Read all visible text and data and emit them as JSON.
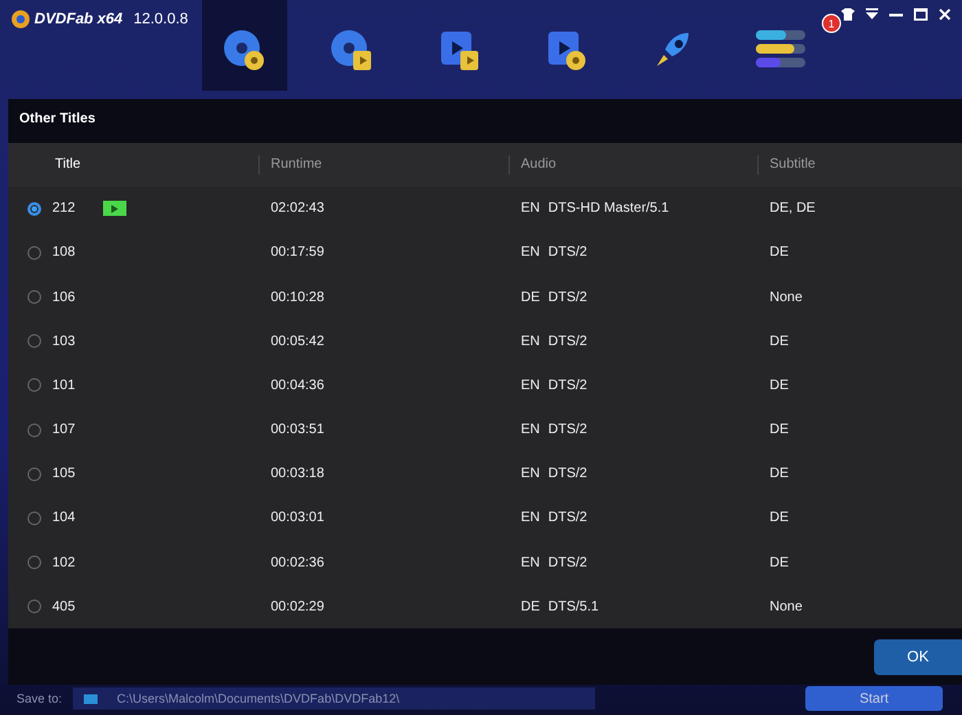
{
  "app": {
    "logo": "DVDFab",
    "edition": "x64",
    "version": "12.0.0.8",
    "notification_count": "1"
  },
  "modules": [
    {
      "kind": "copy",
      "selected": true
    },
    {
      "kind": "ripper",
      "selected": false
    },
    {
      "kind": "converter",
      "selected": false
    },
    {
      "kind": "creator",
      "selected": false
    },
    {
      "kind": "launch",
      "selected": false
    },
    {
      "kind": "queue",
      "selected": false
    }
  ],
  "dialog": {
    "title": "Other Titles",
    "columns": [
      "Title",
      "Runtime",
      "Audio",
      "Subtitle"
    ],
    "rows": [
      {
        "title": "212",
        "preview": true,
        "selected": true,
        "runtime": "02:02:43",
        "audio_language": "EN",
        "audio_format": "DTS-HD Master/5.1",
        "subtitle": "DE, DE"
      },
      {
        "title": "108",
        "preview": false,
        "selected": false,
        "runtime": "00:17:59",
        "audio_language": "EN",
        "audio_format": "DTS/2",
        "subtitle": "DE"
      },
      {
        "title": "106",
        "preview": false,
        "selected": false,
        "runtime": "00:10:28",
        "audio_language": "DE",
        "audio_format": "DTS/2",
        "subtitle": "None"
      },
      {
        "title": "103",
        "preview": false,
        "selected": false,
        "runtime": "00:05:42",
        "audio_language": "EN",
        "audio_format": "DTS/2",
        "subtitle": "DE"
      },
      {
        "title": "101",
        "preview": false,
        "selected": false,
        "runtime": "00:04:36",
        "audio_language": "EN",
        "audio_format": "DTS/2",
        "subtitle": "DE"
      },
      {
        "title": "107",
        "preview": false,
        "selected": false,
        "runtime": "00:03:51",
        "audio_language": "EN",
        "audio_format": "DTS/2",
        "subtitle": "DE"
      },
      {
        "title": "105",
        "preview": false,
        "selected": false,
        "runtime": "00:03:18",
        "audio_language": "EN",
        "audio_format": "DTS/2",
        "subtitle": "DE"
      },
      {
        "title": "104",
        "preview": false,
        "selected": false,
        "runtime": "00:03:01",
        "audio_language": "EN",
        "audio_format": "DTS/2",
        "subtitle": "DE"
      },
      {
        "title": "102",
        "preview": false,
        "selected": false,
        "runtime": "00:02:36",
        "audio_language": "EN",
        "audio_format": "DTS/2",
        "subtitle": "DE"
      },
      {
        "title": "405",
        "preview": false,
        "selected": false,
        "runtime": "00:02:29",
        "audio_language": "DE",
        "audio_format": "DTS/5.1",
        "subtitle": "None"
      }
    ],
    "ok_button": "OK"
  },
  "bottom_bar": {
    "save_to_label": "Save to:",
    "path": "C:\\Users\\Malcolm\\Documents\\DVDFab\\DVDFab12\\",
    "start_button": "Start"
  }
}
